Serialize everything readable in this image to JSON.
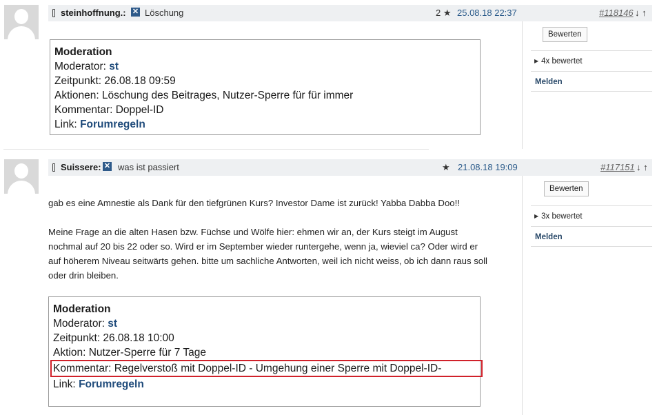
{
  "posts": [
    {
      "author": "steinhoffnung.:",
      "title": "Löschung",
      "stars_count": "2",
      "star_glyph": "★",
      "date": "25.08.18 22:37",
      "post_id": "#118146",
      "arrows": "↓ ↑",
      "rate_button": "Bewerten",
      "rated": "4x bewertet",
      "report": "Melden",
      "moderation": {
        "title": "Moderation",
        "moderator_label": "Moderator: ",
        "moderator": "st",
        "time": "Zeitpunkt: 26.08.18 09:59",
        "actions": "Aktionen: Löschung des Beitrages, Nutzer-Sperre für für immer",
        "comment": "Kommentar: Doppel-ID",
        "link_label": "Link: ",
        "link": "Forumregeln"
      }
    },
    {
      "author": "Suissere:",
      "title": "was ist passiert",
      "star_glyph": "★",
      "date": "21.08.18 19:09",
      "post_id": "#117151",
      "arrows": "↓ ↑",
      "rate_button": "Bewerten",
      "rated": "3x bewertet",
      "report": "Melden",
      "body": [
        "gab es eine Amnestie als Dank für den tiefgrünen Kurs? Investor Dame ist zurück! Yabba Dabba Doo!!",
        "Meine Frage an die alten Hasen bzw. Füchse und Wölfe hier: ehmen wir an, der Kurs steigt im August nochmal auf 20 bis 22 oder so. Wird er im September wieder runtergehe, wenn ja, wieviel ca? Oder wird er auf höherem Niveau seitwärts gehen. bitte um sachliche Antworten, weil ich nicht weiss, ob ich dann raus soll oder drin bleiben."
      ],
      "moderation": {
        "title": "Moderation",
        "moderator_label": "Moderator: ",
        "moderator": "st",
        "time": "Zeitpunkt: 26.08.18 10:00",
        "action": "Aktion: Nutzer-Sperre für 7 Tage",
        "comment": "Kommentar: Regelverstoß mit Doppel-ID - Umgehung einer Sperre mit Doppel-ID-",
        "link_label": "Link: ",
        "link": "Forumregeln"
      }
    }
  ],
  "icons": {
    "message_icon": "message-icon",
    "mobile_icon": "mobile-icon",
    "avatar": "user-avatar-placeholder"
  },
  "colors": {
    "header_bg": "#eef0f2",
    "link": "#1e4a7a",
    "date": "#2a5a8a",
    "highlight_border": "#d0212a"
  }
}
